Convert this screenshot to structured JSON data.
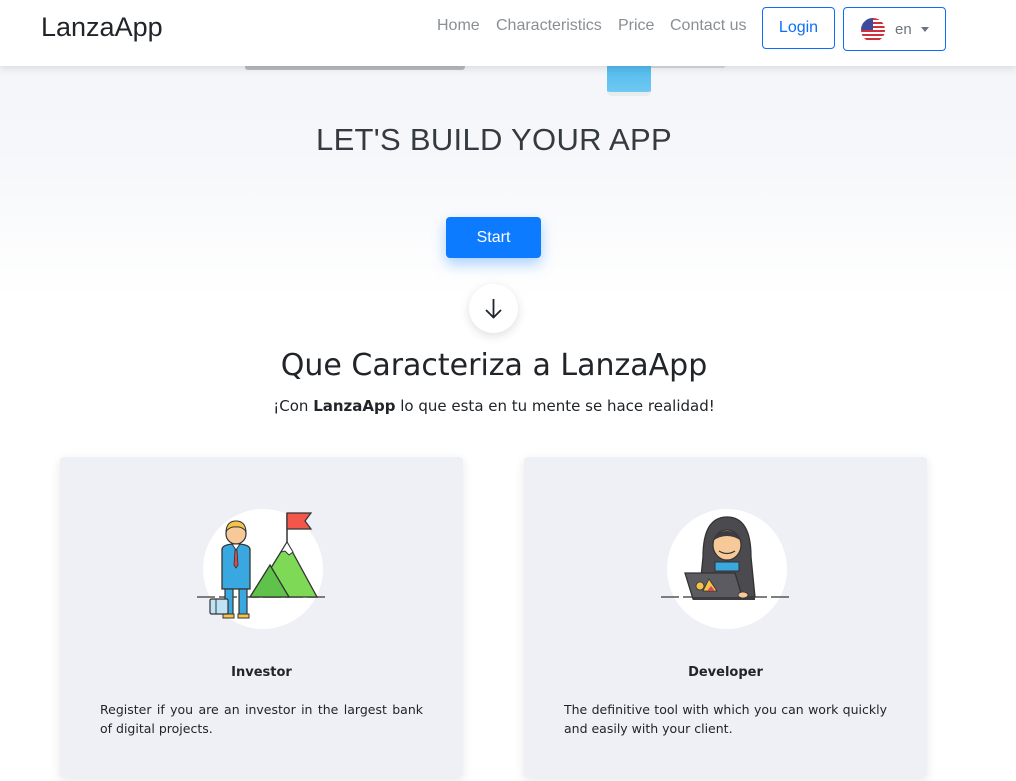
{
  "navbar": {
    "brand": "LanzaApp",
    "links": [
      {
        "label": "Home"
      },
      {
        "label": "Characteristics"
      },
      {
        "label": "Price"
      },
      {
        "label": "Contact us"
      }
    ],
    "login_label": "Login",
    "language": {
      "selected": "en",
      "flag_icon": "us-flag-icon"
    }
  },
  "hero": {
    "title": "LET'S BUILD YOUR APP",
    "start_label": "Start",
    "scroll_icon": "arrow-down-icon"
  },
  "features": {
    "title": "Que Caracteriza a LanzaApp",
    "subtitle_prefix": "¡Con ",
    "subtitle_bold": "LanzaApp",
    "subtitle_suffix": " lo que esta en tu mente se hace realidad!",
    "cards": [
      {
        "icon": "investor-illustration",
        "title": "Investor",
        "text": "Register if you are an investor in the largest bank of digital projects."
      },
      {
        "icon": "developer-illustration",
        "title": "Developer",
        "text": "The definitive tool with which you can work quickly and easily with your client."
      }
    ]
  },
  "colors": {
    "primary": "#0d7bff",
    "nav_text": "#8a8f94",
    "card_bg": "#eef0f5"
  }
}
